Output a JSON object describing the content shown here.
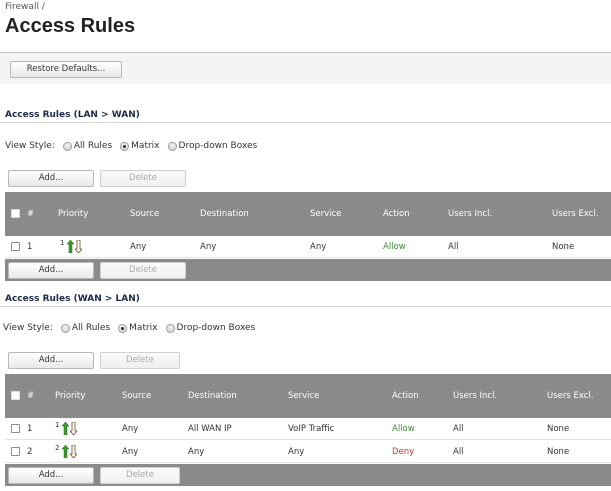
{
  "breadcrumb": "Firewall /",
  "page_title": "Access Rules",
  "restore_button": "Restore Defaults...",
  "sections": [
    {
      "title": "Access Rules (LAN > WAN)",
      "view_style": {
        "label": "View Style:",
        "options": [
          "All Rules",
          "Matrix",
          "Drop-down Boxes"
        ],
        "selected": "Matrix"
      },
      "add_label": "Add...",
      "delete_label": "Delete",
      "columns": [
        "#",
        "Priority",
        "Source",
        "Destination",
        "Service",
        "Action",
        "Users Incl.",
        "Users Excl."
      ],
      "rows": [
        {
          "num": "1",
          "priority": "1",
          "source": "Any",
          "destination": "Any",
          "service": "Any",
          "action": "Allow",
          "users_incl": "All",
          "users_excl": "None"
        }
      ]
    },
    {
      "title": "Access Rules (WAN > LAN)",
      "view_style": {
        "label": "View Style:",
        "options": [
          "All Rules",
          "Matrix",
          "Drop-down Boxes"
        ],
        "selected": "Matrix"
      },
      "add_label": "Add...",
      "delete_label": "Delete",
      "columns": [
        "#",
        "Priority",
        "Source",
        "Destination",
        "Service",
        "Action",
        "Users Incl.",
        "Users Excl."
      ],
      "rows": [
        {
          "num": "1",
          "priority": "1",
          "source": "Any",
          "destination": "All WAN IP",
          "service": "VoIP Traffic",
          "action": "Allow",
          "users_incl": "All",
          "users_excl": "None"
        },
        {
          "num": "2",
          "priority": "2",
          "source": "Any",
          "destination": "Any",
          "service": "Any",
          "action": "Deny",
          "users_incl": "All",
          "users_excl": "None"
        }
      ]
    }
  ],
  "colors": {
    "allow": "#3b8a2f",
    "deny": "#d03030",
    "header_bg": "#8a8a8a",
    "arrow_up": "#3a9a2a",
    "arrow_down": "#6a4a2a"
  }
}
